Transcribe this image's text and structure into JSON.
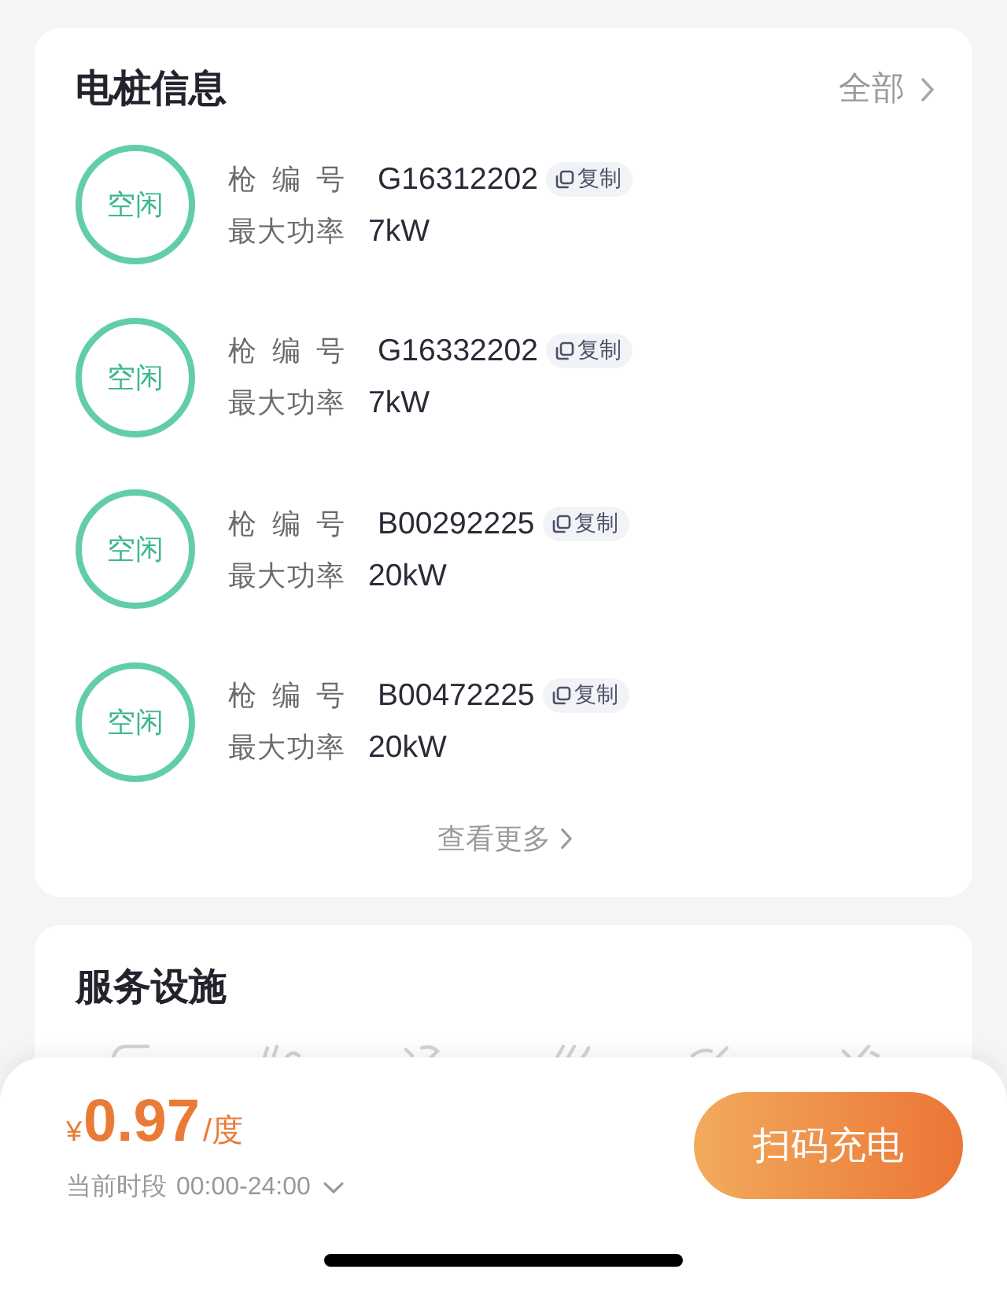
{
  "station_info": {
    "title": "电桩信息",
    "all_link": "全部",
    "guns": [
      {
        "status": "空闲",
        "number_label": "枪 编 号",
        "number": "G16312202",
        "copy_label": "复制",
        "power_label": "最大功率",
        "power": "7kW"
      },
      {
        "status": "空闲",
        "number_label": "枪 编 号",
        "number": "G16332202",
        "copy_label": "复制",
        "power_label": "最大功率",
        "power": "7kW"
      },
      {
        "status": "空闲",
        "number_label": "枪 编 号",
        "number": "B00292225",
        "copy_label": "复制",
        "power_label": "最大功率",
        "power": "20kW"
      },
      {
        "status": "空闲",
        "number_label": "枪 编 号",
        "number": "B00472225",
        "copy_label": "复制",
        "power_label": "最大功率",
        "power": "20kW"
      }
    ],
    "more_link": "查看更多"
  },
  "services": {
    "title": "服务设施"
  },
  "bottom_bar": {
    "currency": "¥",
    "price": "0.97",
    "unit": "/度",
    "period_label": "当前时段",
    "period": "00:00-24:00",
    "scan_button": "扫码充电"
  }
}
